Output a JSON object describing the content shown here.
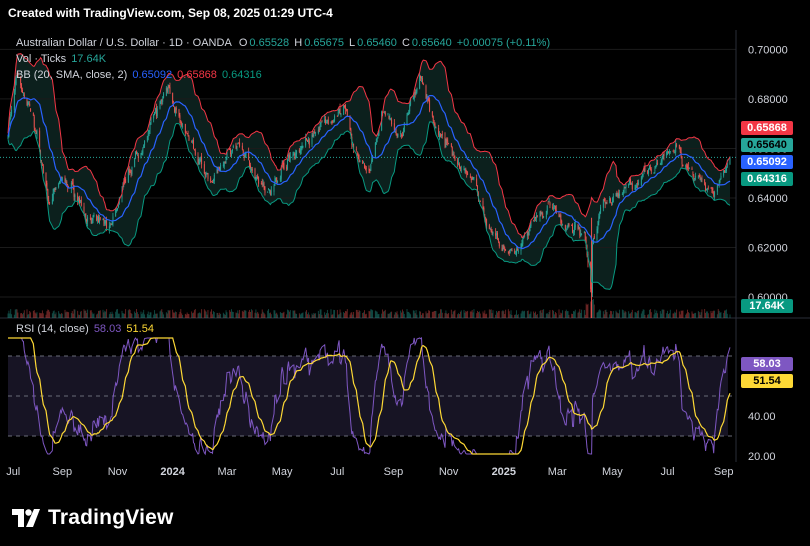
{
  "header": "Created with TradingView.com, Sep 08, 2025 01:29 UTC-4",
  "brand": "TradingView",
  "legend": {
    "symbol": "Australian Dollar / U.S. Dollar · 1D · OANDA",
    "o_label": "O",
    "o": "0.65528",
    "h_label": "H",
    "h": "0.65675",
    "l_label": "L",
    "l": "0.65460",
    "c_label": "C",
    "c": "0.65640",
    "change": "+0.00075 (+0.11%)",
    "vol_label": "Vol · Ticks",
    "vol": "17.64K",
    "bb_label": "BB (20, SMA, close, 2)",
    "bb_mid": "0.65092",
    "bb_upper": "0.65868",
    "bb_lower": "0.64316",
    "rsi_label": "RSI (14, close)",
    "rsi": "58.03",
    "rsi_ma": "51.54"
  },
  "price_labels": {
    "upper": "0.65868",
    "close": "0.65640",
    "mid": "0.65092",
    "lower": "0.64316",
    "volume": "17.64K"
  },
  "rsi_labels": {
    "rsi": "58.03",
    "ma": "51.54"
  },
  "colors": {
    "up": "#26a69a",
    "down": "#ef5350",
    "bb_upper": "#f23645",
    "bb_mid": "#2962ff",
    "bb_lower": "#089981",
    "rsi": "#7e57c2",
    "rsi_ma": "#fdd835",
    "bb_fill": "#0d2420"
  },
  "chart_data": [
    {
      "type": "candlestick",
      "title": "Australian Dollar / U.S. Dollar · 1D · OANDA",
      "x_ticks": [
        "Jul",
        "Sep",
        "Nov",
        "2024",
        "Mar",
        "May",
        "Jul",
        "Sep",
        "Nov",
        "2025",
        "Mar",
        "May",
        "Jul",
        "Sep"
      ],
      "y_ticks": [
        "0.70000",
        "0.68000",
        "0.66000",
        "0.64000",
        "0.62000",
        "0.60000"
      ],
      "ylim": [
        0.5915,
        0.703
      ],
      "close_anchors": [
        [
          "2023-07-03",
          0.666
        ],
        [
          "2023-07-13",
          0.689
        ],
        [
          "2023-07-31",
          0.672
        ],
        [
          "2023-08-10",
          0.653
        ],
        [
          "2023-08-17",
          0.638
        ],
        [
          "2023-09-01",
          0.647
        ],
        [
          "2023-09-15",
          0.643
        ],
        [
          "2023-10-03",
          0.629
        ],
        [
          "2023-10-26",
          0.63
        ],
        [
          "2023-11-15",
          0.652
        ],
        [
          "2023-12-01",
          0.663
        ],
        [
          "2023-12-28",
          0.686
        ],
        [
          "2024-01-10",
          0.669
        ],
        [
          "2024-02-13",
          0.646
        ],
        [
          "2024-03-08",
          0.662
        ],
        [
          "2024-04-19",
          0.642
        ],
        [
          "2024-05-01",
          0.653
        ],
        [
          "2024-05-31",
          0.664
        ],
        [
          "2024-07-08",
          0.676
        ],
        [
          "2024-07-25",
          0.654
        ],
        [
          "2024-08-05",
          0.651
        ],
        [
          "2024-08-20",
          0.674
        ],
        [
          "2024-09-10",
          0.664
        ],
        [
          "2024-09-30",
          0.69
        ],
        [
          "2024-10-22",
          0.664
        ],
        [
          "2024-11-06",
          0.658
        ],
        [
          "2024-11-26",
          0.649
        ],
        [
          "2024-12-20",
          0.624
        ],
        [
          "2025-01-13",
          0.616
        ],
        [
          "2025-01-28",
          0.626
        ],
        [
          "2025-02-20",
          0.637
        ],
        [
          "2025-03-10",
          0.628
        ],
        [
          "2025-03-31",
          0.627
        ],
        [
          "2025-04-08",
          0.599
        ],
        [
          "2025-04-09",
          0.62
        ],
        [
          "2025-04-21",
          0.638
        ],
        [
          "2025-05-15",
          0.643
        ],
        [
          "2025-06-05",
          0.651
        ],
        [
          "2025-07-02",
          0.657
        ],
        [
          "2025-07-10",
          0.66
        ],
        [
          "2025-07-25",
          0.652
        ],
        [
          "2025-08-04",
          0.649
        ],
        [
          "2025-08-20",
          0.642
        ],
        [
          "2025-09-08",
          0.6564
        ]
      ],
      "last_close": 0.6564,
      "bollinger": {
        "period": 20,
        "type": "SMA",
        "mult": 2,
        "last_upper": 0.65868,
        "last_mid": 0.65092,
        "last_lower": 0.64316
      },
      "volume_last": "17.64K"
    },
    {
      "type": "line",
      "title": "RSI (14, close)",
      "series": [
        {
          "name": "RSI",
          "last": 58.03
        },
        {
          "name": "RSI-based MA",
          "last": 51.54
        }
      ],
      "bands": [
        70,
        50,
        30
      ],
      "y_ticks": [
        "40.00",
        "20.00"
      ],
      "ylim": [
        20,
        80
      ]
    }
  ]
}
